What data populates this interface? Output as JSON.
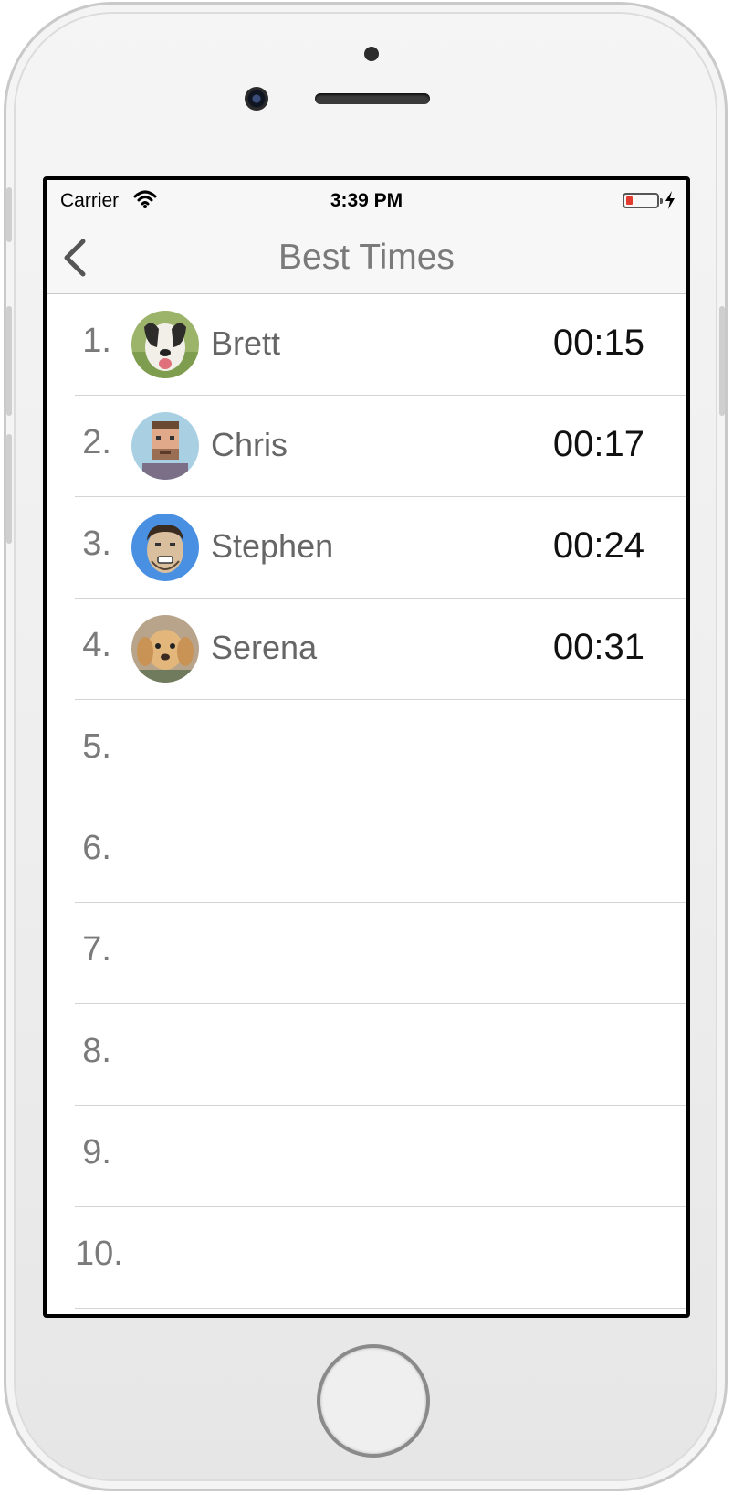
{
  "status": {
    "carrier": "Carrier",
    "time": "3:39 PM"
  },
  "nav": {
    "title": "Best Times"
  },
  "rows": [
    {
      "rank": "1.",
      "name": "Brett",
      "time": "00:15",
      "avatar": "dog-avatar-1"
    },
    {
      "rank": "2.",
      "name": "Chris",
      "time": "00:17",
      "avatar": "pixel-man-avatar"
    },
    {
      "rank": "3.",
      "name": "Stephen",
      "time": "00:24",
      "avatar": "cartoon-man-avatar"
    },
    {
      "rank": "4.",
      "name": "Serena",
      "time": "00:31",
      "avatar": "dog-avatar-2"
    },
    {
      "rank": "5."
    },
    {
      "rank": "6."
    },
    {
      "rank": "7."
    },
    {
      "rank": "8."
    },
    {
      "rank": "9."
    },
    {
      "rank": "10."
    }
  ],
  "colors": {
    "nav_bg": "#f7f7f7",
    "divider": "#d4d4d4",
    "battery_low": "#e23b2f"
  }
}
